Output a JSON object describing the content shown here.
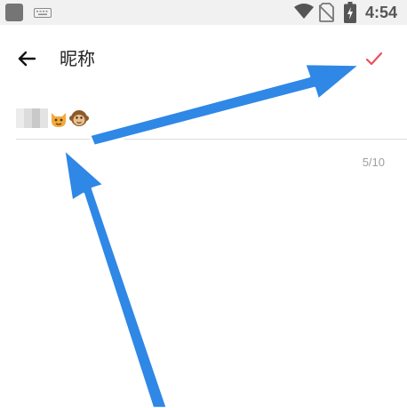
{
  "status_bar": {
    "time": "4:54",
    "icons": [
      "app-icon",
      "keyboard-icon",
      "wifi-icon",
      "no-sim-icon",
      "battery-charging-icon"
    ]
  },
  "toolbar": {
    "back_icon": "arrow-left-icon",
    "title": "昵称",
    "confirm_icon": "check-icon"
  },
  "nickname_input": {
    "value_blurred": true,
    "emojis": [
      "cat-face-emoji",
      "monkey-face-emoji"
    ]
  },
  "char_counter": "5/10",
  "colors": {
    "confirm_check": "#e8505b",
    "annotation_arrow": "#2f87e6",
    "divider": "#dddddd",
    "counter_text": "#9e9e9e",
    "status_bar_bg": "#f1f1f1"
  }
}
